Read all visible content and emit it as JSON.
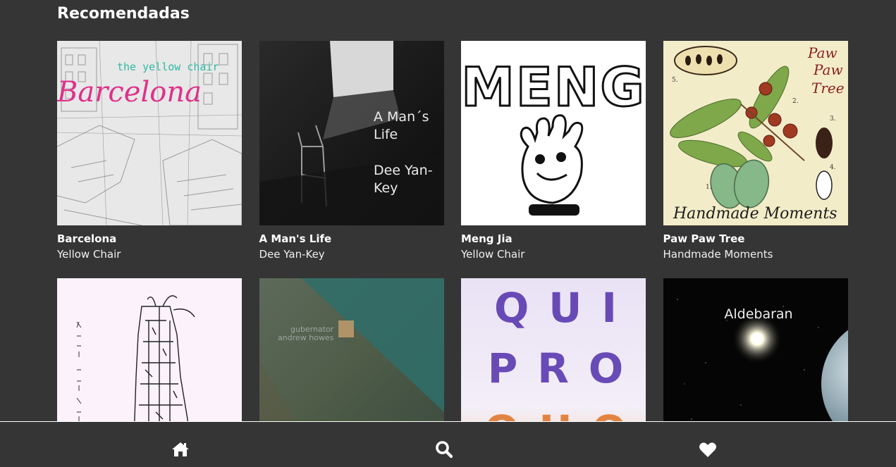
{
  "section": {
    "title": "Recomendadas"
  },
  "albums": [
    {
      "title": "Barcelona",
      "artist": "Yellow Chair",
      "cover_text": [
        "the yellow chair",
        "Barcelona"
      ]
    },
    {
      "title": "A Man's Life",
      "artist": "Dee Yan-Key",
      "cover_text": [
        "A Man´s",
        "Life",
        "Dee Yan-",
        "Key"
      ]
    },
    {
      "title": "Meng Jia",
      "artist": "Yellow Chair",
      "cover_text": [
        "MENG"
      ]
    },
    {
      "title": "Paw Paw Tree",
      "artist": "Handmade Moments",
      "cover_text": [
        "Paw",
        "Paw",
        "Tree",
        "Handmade Moments",
        "1.",
        "2.",
        "3.",
        "4.",
        "5."
      ]
    },
    {
      "title": "",
      "artist": "",
      "cover_text": []
    },
    {
      "title": "",
      "artist": "",
      "cover_text": [
        "gubernator",
        "andrew howes"
      ]
    },
    {
      "title": "",
      "artist": "",
      "cover_text": [
        "QUI",
        "PRO",
        "QUO"
      ]
    },
    {
      "title": "",
      "artist": "",
      "cover_text": [
        "Aldebaran"
      ]
    }
  ],
  "nav": [
    {
      "name": "home",
      "icon": "home-icon"
    },
    {
      "name": "search",
      "icon": "search-icon"
    },
    {
      "name": "favorites",
      "icon": "heart-icon"
    }
  ],
  "colors": {
    "background": "#353535",
    "text": "#ffffff",
    "nav_border": "#ffffff"
  }
}
